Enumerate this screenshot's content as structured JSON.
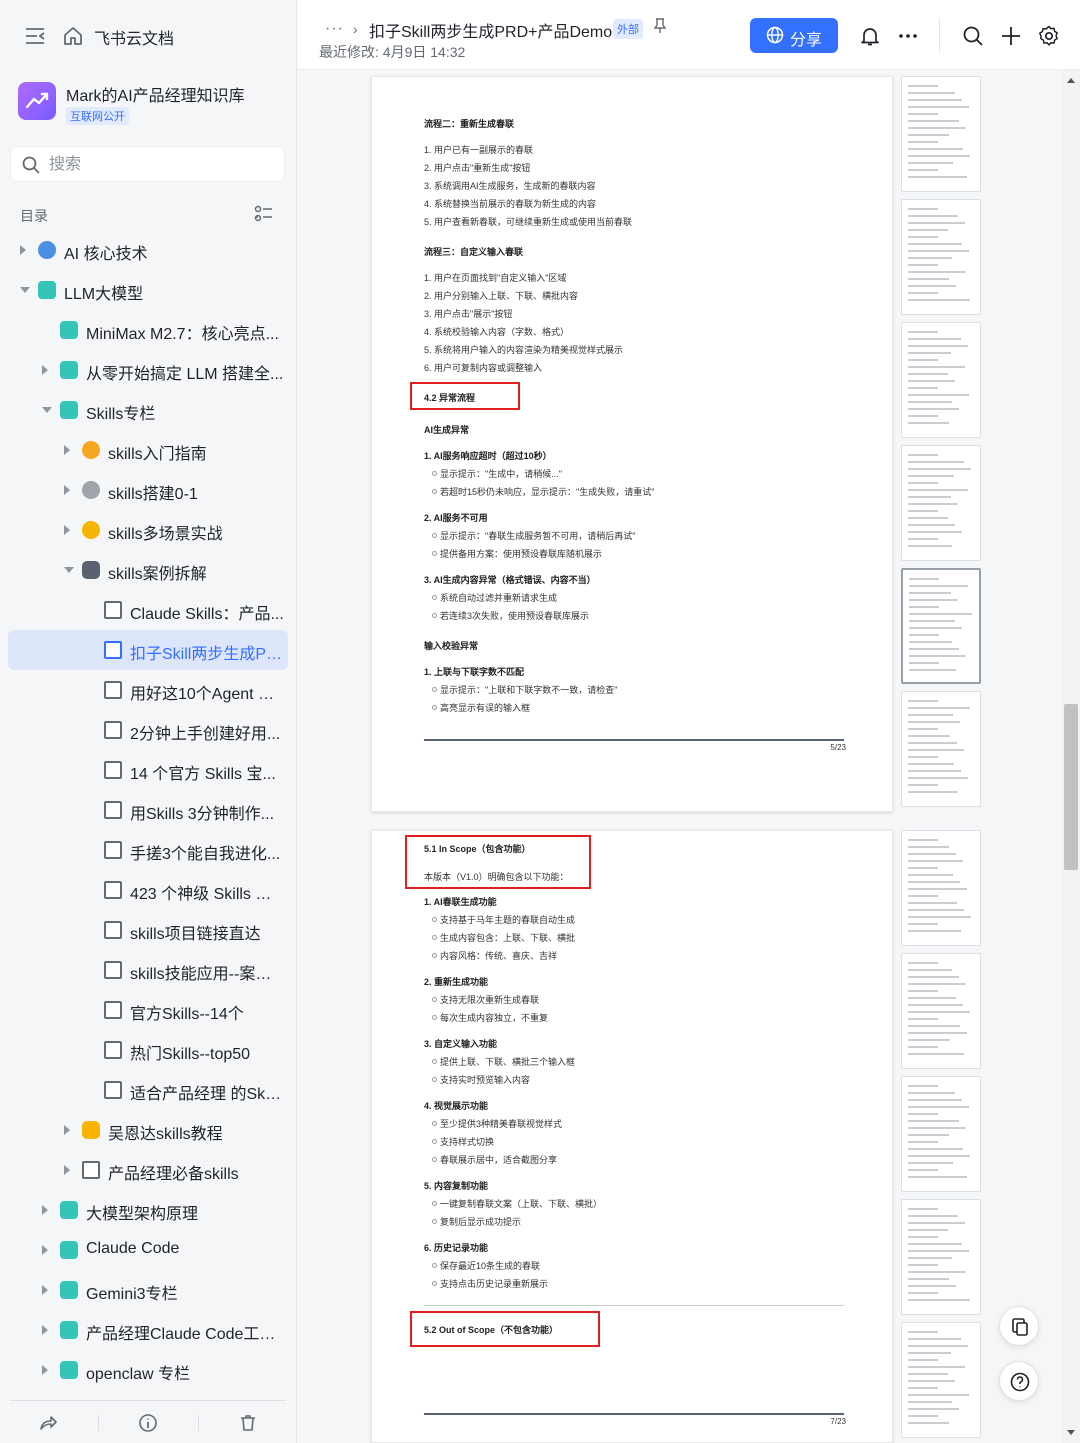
{
  "sidebar": {
    "brand": "飞书云文档",
    "kb_name": "Mark的AI产品经理知识库",
    "kb_badge": "互联网公开",
    "search_placeholder": "搜索",
    "toc_title": "目录",
    "items": [
      {
        "label": "AI 核心技术",
        "level": 0,
        "arrow": "right",
        "icon": "globe-icon"
      },
      {
        "label": "LLM大模型",
        "level": 0,
        "arrow": "down",
        "icon": "tag-icon"
      },
      {
        "label": "MiniMax M2.7：核心亮点...",
        "level": 1,
        "arrow": "",
        "icon": "tag-icon"
      },
      {
        "label": "从零开始搞定 LLM 搭建全...",
        "level": 1,
        "arrow": "right",
        "icon": "tag-icon"
      },
      {
        "label": "Skills专栏",
        "level": 1,
        "arrow": "down",
        "icon": "tag-icon"
      },
      {
        "label": "skills入门指南",
        "level": 2,
        "arrow": "right",
        "icon": "medal-icon"
      },
      {
        "label": "skills搭建0-1",
        "level": 2,
        "arrow": "right",
        "icon": "muscle-icon"
      },
      {
        "label": "skills多场景实战",
        "level": 2,
        "arrow": "right",
        "icon": "lightbulb-icon"
      },
      {
        "label": "skills案例拆解",
        "level": 2,
        "arrow": "down",
        "icon": "robot-icon"
      },
      {
        "label": "Claude Skills：产品...",
        "level": 3,
        "arrow": "",
        "icon": "doc-icon"
      },
      {
        "label": "扣子Skill两步生成PR...",
        "level": 3,
        "arrow": "",
        "icon": "doc-icon",
        "active": true
      },
      {
        "label": "用好这10个Agent Sk...",
        "level": 3,
        "arrow": "",
        "icon": "doc-icon"
      },
      {
        "label": "2分钟上手创建好用...",
        "level": 3,
        "arrow": "",
        "icon": "doc-icon"
      },
      {
        "label": "14 个官方 Skills 宝...",
        "level": 3,
        "arrow": "",
        "icon": "doc-icon"
      },
      {
        "label": "用Skills 3分钟制作...",
        "level": 3,
        "arrow": "",
        "icon": "doc-icon"
      },
      {
        "label": "手搓3个能自我进化...",
        "level": 3,
        "arrow": "",
        "icon": "doc-icon"
      },
      {
        "label": "423 个神级 Skills —...",
        "level": 3,
        "arrow": "",
        "icon": "doc-icon"
      },
      {
        "label": "skills项目链接直达",
        "level": 3,
        "arrow": "",
        "icon": "doc-icon"
      },
      {
        "label": "skills技能应用--案例...",
        "level": 3,
        "arrow": "",
        "icon": "doc-icon"
      },
      {
        "label": "官方Skills--14个",
        "level": 3,
        "arrow": "",
        "icon": "doc-icon"
      },
      {
        "label": "热门Skills--top50",
        "level": 3,
        "arrow": "",
        "icon": "doc-icon"
      },
      {
        "label": "适合产品经理 的Skil...",
        "level": 3,
        "arrow": "",
        "icon": "doc-icon"
      },
      {
        "label": "吴恩达skills教程",
        "level": 2,
        "arrow": "right",
        "icon": "thumbs-up-icon"
      },
      {
        "label": "产品经理必备skills",
        "level": 2,
        "arrow": "right",
        "icon": "doc-icon"
      },
      {
        "label": "大模型架构原理",
        "level": 1,
        "arrow": "right",
        "icon": "tag-icon"
      },
      {
        "label": "Claude Code",
        "level": 1,
        "arrow": "right",
        "icon": "tag-icon"
      },
      {
        "label": "Gemini3专栏",
        "level": 1,
        "arrow": "right",
        "icon": "tag-icon"
      },
      {
        "label": "产品经理Claude Code工作流",
        "level": 1,
        "arrow": "right",
        "icon": "tag-icon"
      },
      {
        "label": "openclaw 专栏",
        "level": 1,
        "arrow": "right",
        "icon": "tag-icon"
      }
    ]
  },
  "header": {
    "more": "···",
    "chevron": "›",
    "title": "扣子Skill两步生成PRD+产品Demo",
    "external_badge": "外部",
    "last_modified": "最近修改: 4月9日 14:32",
    "share_label": "分享"
  },
  "page1": {
    "lines": [
      {
        "text": "流程二：重新生成春联",
        "type": "h"
      },
      {
        "text": "1. 用户已有一副展示的春联",
        "type": "n"
      },
      {
        "text": "2. 用户点击\"重新生成\"按钮",
        "type": "n"
      },
      {
        "text": "3. 系统调用AI生成服务，生成新的春联内容",
        "type": "n"
      },
      {
        "text": "4. 系统替换当前展示的春联为新生成的内容",
        "type": "n"
      },
      {
        "text": "5. 用户查看新春联，可继续重新生成或使用当前春联",
        "type": "n"
      },
      {
        "text": "流程三：自定义输入春联",
        "type": "h"
      },
      {
        "text": "1. 用户在页面找到\"自定义输入\"区域",
        "type": "n"
      },
      {
        "text": "2. 用户分别输入上联、下联、横批内容",
        "type": "n"
      },
      {
        "text": "3. 用户点击\"展示\"按钮",
        "type": "n"
      },
      {
        "text": "4. 系统校验输入内容（字数、格式）",
        "type": "n"
      },
      {
        "text": "5. 系统将用户输入的内容渲染为精美视觉样式展示",
        "type": "n"
      },
      {
        "text": "6. 用户可复制内容或调整输入",
        "type": "n"
      },
      {
        "text": "AI生成异常",
        "type": "h"
      },
      {
        "text": "1. AI服务响应超时（超过10秒）",
        "type": "h"
      },
      {
        "text": "显示提示：\"生成中，请稍候...\"",
        "type": "b"
      },
      {
        "text": "若超时15秒仍未响应，显示提示：\"生成失败，请重试\"",
        "type": "b"
      },
      {
        "text": "2. AI服务不可用",
        "type": "h"
      },
      {
        "text": "显示提示：\"春联生成服务暂不可用，请稍后再试\"",
        "type": "b"
      },
      {
        "text": "提供备用方案：使用预设春联库随机展示",
        "type": "b"
      },
      {
        "text": "3. AI生成内容异常（格式错误、内容不当）",
        "type": "h"
      },
      {
        "text": "系统自动过滤并重新请求生成",
        "type": "b"
      },
      {
        "text": "若连续3次失败，使用预设春联库展示",
        "type": "b"
      },
      {
        "text": "输入校验异常",
        "type": "h"
      },
      {
        "text": "1. 上联与下联字数不匹配",
        "type": "h"
      },
      {
        "text": "显示提示：\"上联和下联字数不一致，请检查\"",
        "type": "b"
      },
      {
        "text": "高亮显示有误的输入框",
        "type": "b"
      }
    ],
    "section_label": "4.2 异常流程",
    "page_num": "5/23"
  },
  "page2": {
    "section_label": "5.1 In Scope（包含功能）",
    "section_desc": "本版本（V1.0）明确包含以下功能：",
    "lines": [
      {
        "text": "1. AI春联生成功能",
        "type": "h"
      },
      {
        "text": "支持基于马年主题的春联自动生成",
        "type": "b"
      },
      {
        "text": "生成内容包含：上联、下联、横批",
        "type": "b"
      },
      {
        "text": "内容风格：传统、喜庆、吉祥",
        "type": "b"
      },
      {
        "text": "2. 重新生成功能",
        "type": "h"
      },
      {
        "text": "支持无限次重新生成春联",
        "type": "b"
      },
      {
        "text": "每次生成内容独立，不重复",
        "type": "b"
      },
      {
        "text": "3. 自定义输入功能",
        "type": "h"
      },
      {
        "text": "提供上联、下联、横批三个输入框",
        "type": "b"
      },
      {
        "text": "支持实时预览输入内容",
        "type": "b"
      },
      {
        "text": "4. 视觉展示功能",
        "type": "h"
      },
      {
        "text": "至少提供3种精美春联视觉样式",
        "type": "b"
      },
      {
        "text": "支持样式切换",
        "type": "b"
      },
      {
        "text": "春联展示居中，适合截图分享",
        "type": "b"
      },
      {
        "text": "5. 内容复制功能",
        "type": "h"
      },
      {
        "text": "一键复制春联文案（上联、下联、横批）",
        "type": "b"
      },
      {
        "text": "复制后显示成功提示",
        "type": "b"
      },
      {
        "text": "6. 历史记录功能",
        "type": "h"
      },
      {
        "text": "保存最近10条生成的春联",
        "type": "b"
      },
      {
        "text": "支持点击历史记录重新展示",
        "type": "b"
      }
    ],
    "section2_label": "5.2 Out of Scope（不包含功能）",
    "page_num": "7/23"
  },
  "colors": {
    "accent": "#3370ff",
    "highlight_box": "#e02020",
    "active_bg": "#dde5fb"
  }
}
